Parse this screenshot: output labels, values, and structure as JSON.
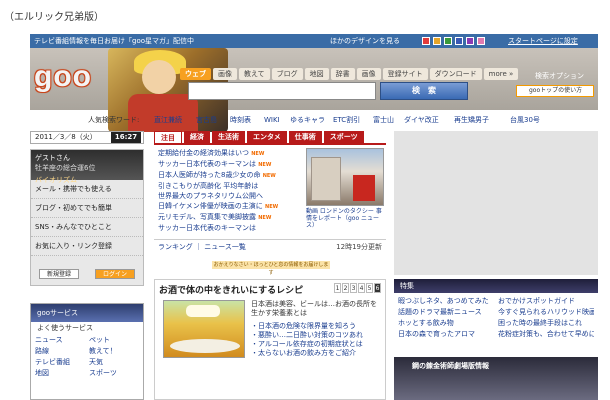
{
  "caption": "（エルリック兄弟版）",
  "topbar": {
    "promo": "テレビ番組情報を毎日お届け「goo星マガ」配信中",
    "design_link": "ほかのデザインを見る",
    "startpage": "スタートページに設定"
  },
  "header": {
    "logo": "goo",
    "tabs": [
      "ウェブ",
      "画像",
      "教えて",
      "ブログ",
      "地図",
      "辞書",
      "画像",
      "登録サイト",
      "ダウンロード",
      "more »"
    ],
    "search_placeholder": "",
    "search_button": "検　索",
    "options_label": "検索オプション",
    "top_button": "gooトップの使い方"
  },
  "keywords": {
    "label": "人気検索ワード:",
    "words": [
      "直江兼続",
      "宮古島",
      "時刻表",
      "WIKI",
      "ゆるキャラ",
      "ETC割引",
      "富士山",
      "ダイヤ改正",
      "再生矯男子",
      "台風30号"
    ]
  },
  "left": {
    "date": "2011／3／8（火）",
    "time": "16:27",
    "login_title": "ゲストさん",
    "login_name": "牡羊座の総合運6位",
    "login_sub": "バイオリズム",
    "menu": [
      "メール・携帯でも使える",
      "ブログ・初めてでも簡単",
      "SNS・みんなでひとこと",
      "お気に入り・リンク登録"
    ],
    "btn_register": "新規登録",
    "btn_login": "ログイン",
    "service_header": "gooサービス",
    "service_sub": "よく使うサービス",
    "service_links": [
      "ニュース",
      "ペット",
      "路線",
      "教えて！",
      "テレビ番組",
      "天気",
      "地図",
      "スポーツ"
    ]
  },
  "news": {
    "tabs": [
      "注目",
      "経済",
      "生活術",
      "エンタメ",
      "仕事術",
      "スポーツ"
    ],
    "new_label": "NEW",
    "items": [
      "定期給付金の経済効果はいつ",
      "サッカー日本代表のキーマンは",
      "日本人医師が持った8歳少女の命",
      "引きこもりが高齢化 平均年齢は",
      "世界最大のプラネタリウム公開へ",
      "日韓イケメン俳優が映画の主演に",
      "元リモデル、写真集で美脚披露",
      "サッカー日本代表のキーマンは"
    ],
    "photo_caption": "動画 ロンドンのタクシー 事情をレポート（goo ニュース）",
    "ranking": "ランキング ｜ ニュース一覧",
    "updated": "12時19分更新"
  },
  "ad_strip": "おかえりなさい・ほっとひと息の情報をお届けします",
  "topic": {
    "title": "お酒で体の中をきれいにするレシピ",
    "pages": [
      "1",
      "2",
      "3",
      "4",
      "5",
      "6"
    ],
    "desc": "日本酒は美容、ビールは…お酒の長所を生かす栄養素とは",
    "bullets": [
      "・日本酒の危険な限界量を知ろう",
      "・悪酔い…二日酔い対策のコツあれ",
      "・アルコール依存症の初期症状とは",
      "・太らないお酒の飲み方をご紹介"
    ]
  },
  "feature": {
    "header": "特集",
    "links": [
      "暇つぶしネタ、あつめてみた",
      "おでかけスポットガイド",
      "話題のドラマ最新ニュース",
      "今すぐ見られるハリウッド映画",
      "ホッとする飲み物",
      "困った時の最終手段はこれ",
      "日本の森で育ったアロマ",
      "花粉症対策も、合わせて早めに"
    ]
  },
  "banner": "鋼の錬金術師劇場版情報"
}
